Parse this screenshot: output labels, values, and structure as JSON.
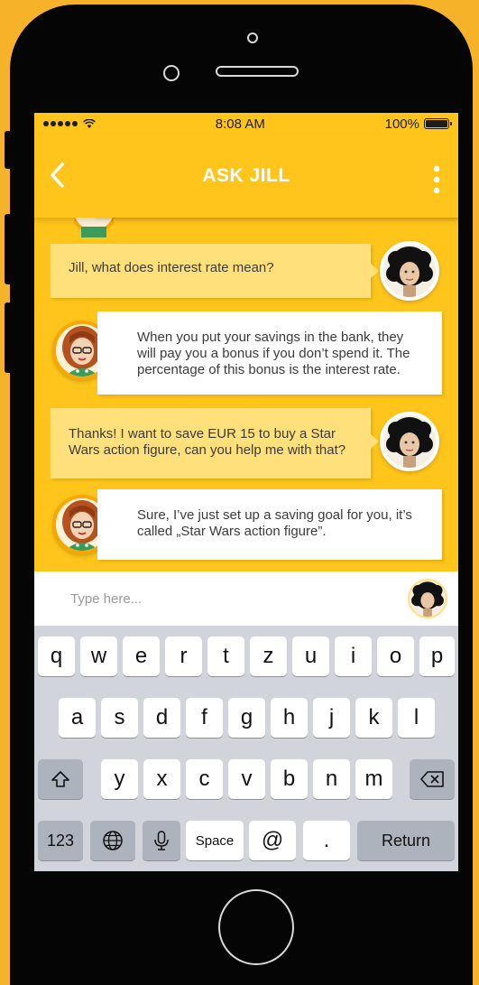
{
  "colors": {
    "background": "#f6b32a",
    "app_accent": "#ffc51a",
    "user_bubble": "#ffe07a",
    "jill_bubble": "#ffffff"
  },
  "status_bar": {
    "time": "8:08 AM",
    "battery": "100%",
    "battery_level": 1.0
  },
  "header": {
    "title": "ASK JILL",
    "back_icon": "chevron-left-icon",
    "menu_icon": "vertical-ellipsis-icon"
  },
  "messages": [
    {
      "sender": "user",
      "text": "Jill, what does interest rate mean?"
    },
    {
      "sender": "jill",
      "text": "When you put your savings in the bank, they will pay you a bonus if you don’t spend it. The percentage of this bonus is the interest rate."
    },
    {
      "sender": "user",
      "text": "Thanks! I want to save EUR 15 to buy a Star Wars action figure, can you help me with that?"
    },
    {
      "sender": "jill",
      "text": "Sure, I’ve just set up a saving goal for you, it’s called „Star Wars action figure”."
    }
  ],
  "input": {
    "placeholder": "Type here..."
  },
  "keyboard": {
    "row1": [
      "q",
      "w",
      "e",
      "r",
      "t",
      "z",
      "u",
      "i",
      "o",
      "p"
    ],
    "row2": [
      "a",
      "s",
      "d",
      "f",
      "g",
      "h",
      "j",
      "k",
      "l"
    ],
    "row3": [
      "y",
      "x",
      "c",
      "v",
      "b",
      "n",
      "m"
    ],
    "numbers": "123",
    "space": "Space",
    "at": "@",
    "period": ".",
    "return": "Return"
  }
}
